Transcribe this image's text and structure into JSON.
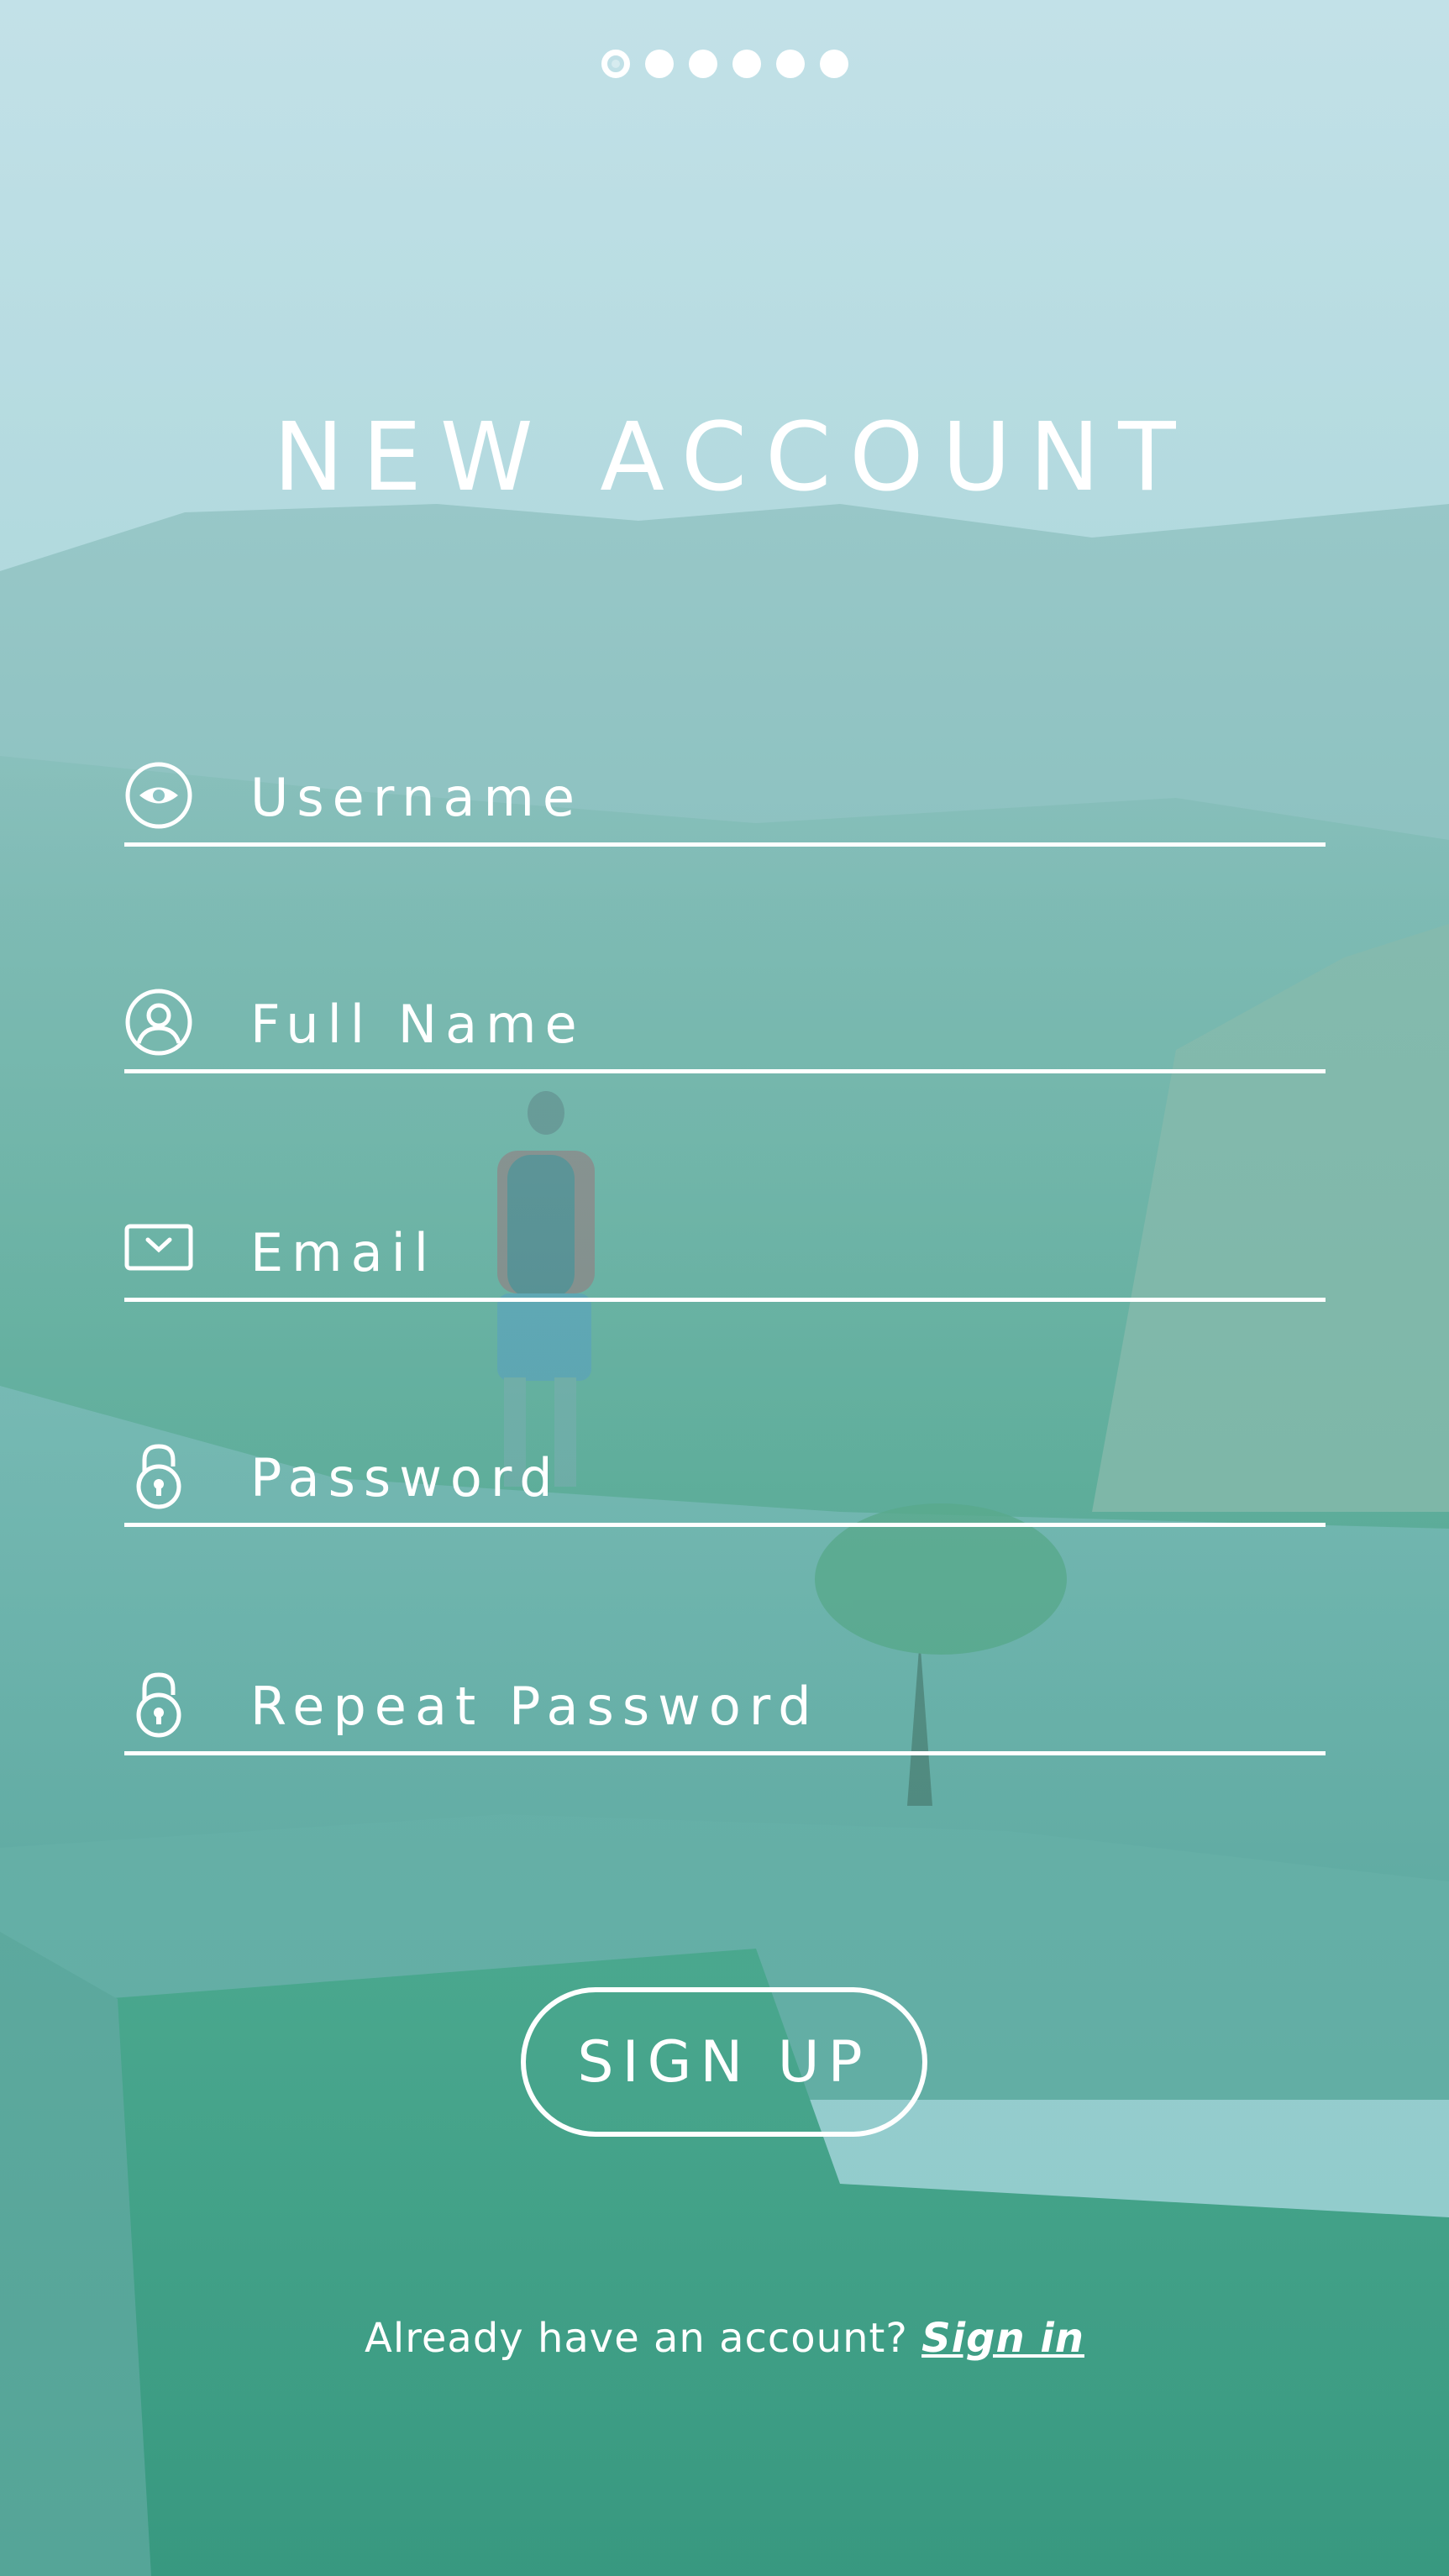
{
  "pagination": {
    "total": 6,
    "active_index": 0
  },
  "title": "NEW ACCOUNT",
  "fields": {
    "username": {
      "placeholder": "Username",
      "value": "",
      "icon": "eye-icon"
    },
    "full_name": {
      "placeholder": "Full Name",
      "value": "",
      "icon": "user-avatar-icon"
    },
    "email": {
      "placeholder": "Email",
      "value": "",
      "icon": "envelope-icon"
    },
    "password": {
      "placeholder": "Password",
      "value": "",
      "icon": "padlock-icon"
    },
    "repeat_password": {
      "placeholder": "Repeat Password",
      "value": "",
      "icon": "padlock-icon"
    }
  },
  "signup_button": {
    "label": "SIGN UP"
  },
  "footer": {
    "prompt": "Already have an account?",
    "link": "Sign in"
  },
  "colors": {
    "foreground": "#ffffff",
    "tint_top": "#b0dce4",
    "tint_bottom": "#46b0a0"
  }
}
